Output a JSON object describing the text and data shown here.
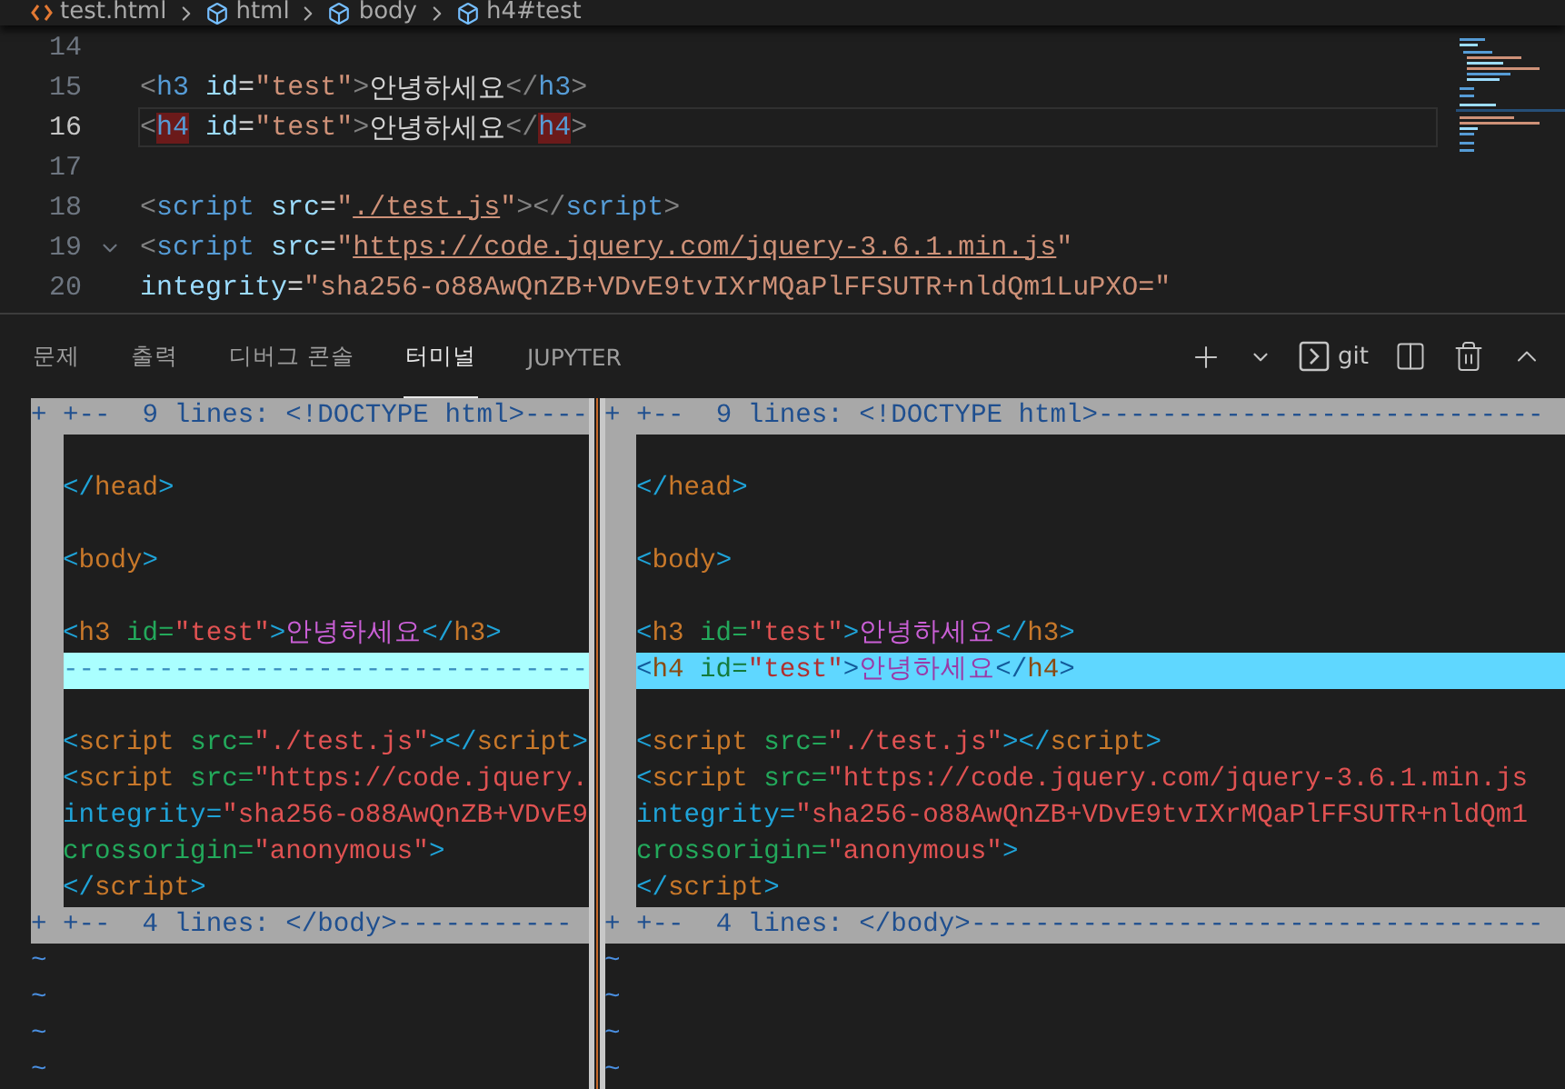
{
  "breadcrumb": [
    {
      "kind": "file",
      "label": "test.html"
    },
    {
      "kind": "symbol",
      "label": "html"
    },
    {
      "kind": "symbol",
      "label": "body"
    },
    {
      "kind": "symbol",
      "label": "h4#test"
    }
  ],
  "editor": {
    "lines": [
      {
        "number": "14",
        "current": false,
        "fold_marker": false
      },
      {
        "number": "15",
        "current": false,
        "fold_marker": false,
        "tokens": [
          {
            "t": "<",
            "kind": "br"
          },
          {
            "t": "h3",
            "kind": "tag"
          },
          {
            "t": " id",
            "kind": "attr"
          },
          {
            "t": "=",
            "kind": "text"
          },
          {
            "t": "\"test\"",
            "kind": "str"
          },
          {
            "t": ">",
            "kind": "br"
          },
          {
            "t": "안녕하세요",
            "kind": "text"
          },
          {
            "t": "</",
            "kind": "br"
          },
          {
            "t": "h3",
            "kind": "tag"
          },
          {
            "t": ">",
            "kind": "br"
          }
        ]
      },
      {
        "number": "16",
        "current": true,
        "fold_marker": false,
        "tokens": [
          {
            "t": "<",
            "kind": "br"
          },
          {
            "t": "h4",
            "kind": "taghl"
          },
          {
            "t": " id",
            "kind": "attr"
          },
          {
            "t": "=",
            "kind": "text"
          },
          {
            "t": "\"test\"",
            "kind": "str"
          },
          {
            "t": ">",
            "kind": "br"
          },
          {
            "t": "안녕하세요",
            "kind": "text"
          },
          {
            "t": "</",
            "kind": "br"
          },
          {
            "t": "h4",
            "kind": "taghl"
          },
          {
            "t": ">",
            "kind": "br"
          }
        ]
      },
      {
        "number": "17",
        "current": false,
        "fold_marker": false
      },
      {
        "number": "18",
        "current": false,
        "fold_marker": false,
        "tokens": [
          {
            "t": "<",
            "kind": "br"
          },
          {
            "t": "script",
            "kind": "tag"
          },
          {
            "t": " src",
            "kind": "attr"
          },
          {
            "t": "=",
            "kind": "text"
          },
          {
            "t": "\"",
            "kind": "str"
          },
          {
            "t": "./test.js",
            "kind": "link"
          },
          {
            "t": "\"",
            "kind": "str"
          },
          {
            "t": "></",
            "kind": "br"
          },
          {
            "t": "script",
            "kind": "tag"
          },
          {
            "t": ">",
            "kind": "br"
          }
        ]
      },
      {
        "number": "19",
        "current": false,
        "fold_marker": true,
        "tokens": [
          {
            "t": "<",
            "kind": "br"
          },
          {
            "t": "script",
            "kind": "tag"
          },
          {
            "t": " src",
            "kind": "attr"
          },
          {
            "t": "=",
            "kind": "text"
          },
          {
            "t": "\"",
            "kind": "str"
          },
          {
            "t": "https://code.jquery.com/jquery-3.6.1.min.js",
            "kind": "link"
          },
          {
            "t": "\"",
            "kind": "str"
          }
        ]
      },
      {
        "number": "20",
        "current": false,
        "fold_marker": false,
        "tokens": [
          {
            "t": "integrity",
            "kind": "attr"
          },
          {
            "t": "=",
            "kind": "text"
          },
          {
            "t": "\"sha256-o88AwQnZB+VDvE9tvIXrMQaPlFFSUTR+nldQm1LuPXO=\"",
            "kind": "str"
          }
        ]
      }
    ]
  },
  "panel": {
    "tabs": [
      {
        "label": "문제",
        "selected": false
      },
      {
        "label": "출력",
        "selected": false
      },
      {
        "label": "디버그 콘솔",
        "selected": false
      },
      {
        "label": "터미널",
        "selected": true
      },
      {
        "label": "JUPYTER",
        "selected": false
      }
    ],
    "toolbar": [
      {
        "kind": "add"
      },
      {
        "kind": "dropdown"
      },
      {
        "kind": "terminal",
        "label": "git"
      },
      {
        "kind": "split"
      },
      {
        "kind": "trash"
      },
      {
        "kind": "collapse"
      }
    ]
  },
  "terminal": {
    "panes": [
      {
        "lines": [
          {
            "kind": "fold",
            "text": "+ +--  9 lines: <!DOCTYPE html>----"
          },
          {
            "kind": "blank"
          },
          {
            "kind": "code",
            "tokens": [
              {
                "t": "</",
                "kind": "blue"
              },
              {
                "t": "head",
                "kind": "orange"
              },
              {
                "t": ">",
                "kind": "blue"
              }
            ]
          },
          {
            "kind": "blank"
          },
          {
            "kind": "code",
            "tokens": [
              {
                "t": "<",
                "kind": "blue"
              },
              {
                "t": "body",
                "kind": "orange"
              },
              {
                "t": ">",
                "kind": "blue"
              }
            ]
          },
          {
            "kind": "blank"
          },
          {
            "kind": "code",
            "tokens": [
              {
                "t": "<",
                "kind": "blue"
              },
              {
                "t": "h3",
                "kind": "orange"
              },
              {
                "t": " id=",
                "kind": "green"
              },
              {
                "t": "\"test\"",
                "kind": "red"
              },
              {
                "t": ">",
                "kind": "blue"
              },
              {
                "t": "안녕하세요",
                "kind": "magenta"
              },
              {
                "t": "</",
                "kind": "blue"
              },
              {
                "t": "h3",
                "kind": "orange"
              },
              {
                "t": ">",
                "kind": "blue"
              }
            ]
          },
          {
            "kind": "filler",
            "text": "---------------------------------"
          },
          {
            "kind": "blank"
          },
          {
            "kind": "code",
            "tokens": [
              {
                "t": "<",
                "kind": "blue"
              },
              {
                "t": "script",
                "kind": "orange"
              },
              {
                "t": " src=",
                "kind": "green"
              },
              {
                "t": "\"./test.js\"",
                "kind": "red"
              },
              {
                "t": "></",
                "kind": "blue"
              },
              {
                "t": "script",
                "kind": "orange"
              },
              {
                "t": ">",
                "kind": "blue"
              }
            ]
          },
          {
            "kind": "code",
            "tokens": [
              {
                "t": "<",
                "kind": "blue"
              },
              {
                "t": "script",
                "kind": "orange"
              },
              {
                "t": " src=",
                "kind": "green"
              },
              {
                "t": "\"https://code.jquery.",
                "kind": "red"
              }
            ]
          },
          {
            "kind": "code",
            "tokens": [
              {
                "t": "integrity=",
                "kind": "blue"
              },
              {
                "t": "\"sha256-o88AwQnZB+VDvE9",
                "kind": "red"
              }
            ]
          },
          {
            "kind": "code",
            "tokens": [
              {
                "t": "crossorigin=",
                "kind": "green"
              },
              {
                "t": "\"anonymous\"",
                "kind": "red"
              },
              {
                "t": ">",
                "kind": "blue"
              }
            ]
          },
          {
            "kind": "code",
            "tokens": [
              {
                "t": "</",
                "kind": "blue"
              },
              {
                "t": "script",
                "kind": "orange"
              },
              {
                "t": ">",
                "kind": "blue"
              }
            ]
          },
          {
            "kind": "fold",
            "text": "+ +--  4 lines: </body>-----------"
          },
          {
            "kind": "tilde",
            "text": "~"
          },
          {
            "kind": "tilde",
            "text": "~"
          },
          {
            "kind": "tilde",
            "text": "~"
          },
          {
            "kind": "tilde",
            "text": "~"
          }
        ]
      },
      {
        "lines": [
          {
            "kind": "fold",
            "text": "+ +--  9 lines: <!DOCTYPE html>----------------------------"
          },
          {
            "kind": "blank"
          },
          {
            "kind": "code",
            "tokens": [
              {
                "t": "</",
                "kind": "blue"
              },
              {
                "t": "head",
                "kind": "orange"
              },
              {
                "t": ">",
                "kind": "blue"
              }
            ]
          },
          {
            "kind": "blank"
          },
          {
            "kind": "code",
            "tokens": [
              {
                "t": "<",
                "kind": "blue"
              },
              {
                "t": "body",
                "kind": "orange"
              },
              {
                "t": ">",
                "kind": "blue"
              }
            ]
          },
          {
            "kind": "blank"
          },
          {
            "kind": "code",
            "tokens": [
              {
                "t": "<",
                "kind": "blue"
              },
              {
                "t": "h3",
                "kind": "orange"
              },
              {
                "t": " id=",
                "kind": "green"
              },
              {
                "t": "\"test\"",
                "kind": "red"
              },
              {
                "t": ">",
                "kind": "blue"
              },
              {
                "t": "안녕하세요",
                "kind": "magenta"
              },
              {
                "t": "</",
                "kind": "blue"
              },
              {
                "t": "h3",
                "kind": "orange"
              },
              {
                "t": ">",
                "kind": "blue"
              }
            ]
          },
          {
            "kind": "added",
            "tokens": [
              {
                "t": "<",
                "kind": "blue"
              },
              {
                "t": "h4",
                "kind": "orange"
              },
              {
                "t": " id=",
                "kind": "green"
              },
              {
                "t": "\"test\"",
                "kind": "red"
              },
              {
                "t": ">",
                "kind": "blue"
              },
              {
                "t": "안녕하세요",
                "kind": "magenta"
              },
              {
                "t": "</",
                "kind": "blue"
              },
              {
                "t": "h4",
                "kind": "orange"
              },
              {
                "t": ">",
                "kind": "blue"
              }
            ]
          },
          {
            "kind": "blank"
          },
          {
            "kind": "code",
            "tokens": [
              {
                "t": "<",
                "kind": "blue"
              },
              {
                "t": "script",
                "kind": "orange"
              },
              {
                "t": " src=",
                "kind": "green"
              },
              {
                "t": "\"./test.js\"",
                "kind": "red"
              },
              {
                "t": "></",
                "kind": "blue"
              },
              {
                "t": "script",
                "kind": "orange"
              },
              {
                "t": ">",
                "kind": "blue"
              }
            ]
          },
          {
            "kind": "code",
            "tokens": [
              {
                "t": "<",
                "kind": "blue"
              },
              {
                "t": "script",
                "kind": "orange"
              },
              {
                "t": " src=",
                "kind": "green"
              },
              {
                "t": "\"https://code.jquery.com/jquery-3.6.1.min.js",
                "kind": "red"
              }
            ]
          },
          {
            "kind": "code",
            "tokens": [
              {
                "t": "integrity=",
                "kind": "blue"
              },
              {
                "t": "\"sha256-o88AwQnZB+VDvE9tvIXrMQaPlFFSUTR+nldQm1",
                "kind": "red"
              }
            ]
          },
          {
            "kind": "code",
            "tokens": [
              {
                "t": "crossorigin=",
                "kind": "green"
              },
              {
                "t": "\"anonymous\"",
                "kind": "red"
              },
              {
                "t": ">",
                "kind": "blue"
              }
            ]
          },
          {
            "kind": "code",
            "tokens": [
              {
                "t": "</",
                "kind": "blue"
              },
              {
                "t": "script",
                "kind": "orange"
              },
              {
                "t": ">",
                "kind": "blue"
              }
            ]
          },
          {
            "kind": "fold",
            "text": "+ +--  4 lines: </body>------------------------------------"
          },
          {
            "kind": "tilde",
            "text": "~"
          },
          {
            "kind": "tilde",
            "text": "~"
          },
          {
            "kind": "tilde",
            "text": "~"
          },
          {
            "kind": "tilde",
            "text": "~"
          }
        ]
      }
    ]
  }
}
